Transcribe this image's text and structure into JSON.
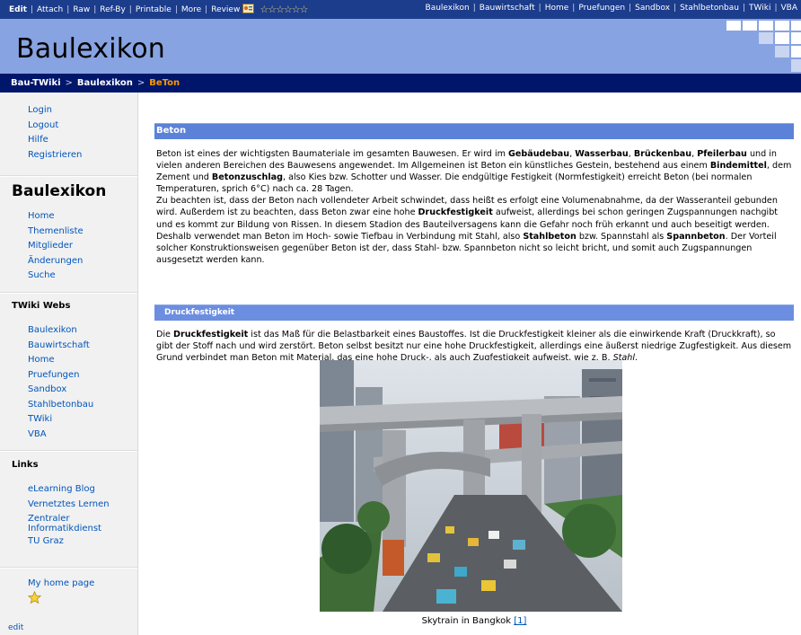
{
  "toolbar": {
    "actions": [
      "Edit",
      "Attach",
      "Raw",
      "Ref-By",
      "Printable",
      "More",
      "Review"
    ],
    "rating_stars": "☆☆☆☆☆☆",
    "webs": [
      "Baulexikon",
      "Bauwirtschaft",
      "Home",
      "Pruefungen",
      "Sandbox",
      "Stahlbetonbau",
      "TWiki",
      "VBA"
    ]
  },
  "header": {
    "title": "Baulexikon"
  },
  "breadcrumb": {
    "root": "Bau-TWiki",
    "sep": ">",
    "web": "Baulexikon",
    "current": "BeTon"
  },
  "sidebar": {
    "user_links": [
      "Login",
      "Logout",
      "Hilfe",
      "Registrieren"
    ],
    "web_title": "Baulexikon",
    "web_links": [
      "Home",
      "Themenliste",
      "Mitglieder",
      "Änderungen",
      "Suche"
    ],
    "webs_heading": "TWiki Webs",
    "webs": [
      "Baulexikon",
      "Bauwirtschaft",
      "Home",
      "Pruefungen",
      "Sandbox",
      "Stahlbetonbau",
      "TWiki",
      "VBA"
    ],
    "links_heading": "Links",
    "links": [
      "eLearning Blog",
      "Vernetztes Lernen",
      "Zentraler Informatikdienst",
      "TU Graz"
    ],
    "home_page": "My home page",
    "edit": "edit"
  },
  "content": {
    "section1_title": "Beton",
    "section1_text": [
      {
        "t": "Beton ist eines der wichtigsten Baumateriale im gesamten Bauwesen. Er wird im "
      },
      {
        "b": "Gebäudebau"
      },
      {
        "t": ", "
      },
      {
        "b": "Wasserbau"
      },
      {
        "t": ", "
      },
      {
        "b": "Brückenbau"
      },
      {
        "t": ", "
      },
      {
        "b": "Pfeilerbau"
      },
      {
        "t": " und in vielen anderen Bereichen des Bauwesens angewendet. Im Allgemeinen ist Beton ein künstliches Gestein, bestehend aus einem "
      },
      {
        "b": "Bindemittel"
      },
      {
        "t": ", dem Zement und "
      },
      {
        "b": "Betonzuschlag"
      },
      {
        "t": ", also Kies bzw. Schotter und Wasser. Die endgültige Festigkeit (Normfestigkeit) erreicht Beton (bei normalen Temperaturen, sprich 6°C) nach ca. 28 Tagen."
      },
      {
        "br": true
      },
      {
        "t": "Zu beachten ist, dass der Beton nach vollendeter Arbeit schwindet, dass heißt es erfolgt eine Volumenabnahme, da der Wasseranteil gebunden wird. Außerdem ist zu beachten, dass Beton zwar eine hohe "
      },
      {
        "b": "Druckfestigkeit"
      },
      {
        "t": " aufweist, allerdings bei schon geringen Zugspannungen nachgibt und es kommt zur Bildung von Rissen. In diesem Stadion des Bauteilversagens kann die Gefahr noch früh erkannt und auch beseitigt werden. Deshalb verwendet man Beton im Hoch- sowie Tiefbau in Verbindung mit Stahl, also "
      },
      {
        "b": "Stahlbeton"
      },
      {
        "t": " bzw. Spannstahl als "
      },
      {
        "b": "Spannbeton"
      },
      {
        "t": ". Der Vorteil solcher Konstruktionsweisen gegenüber Beton ist der, dass Stahl- bzw. Spannbeton nicht so leicht bricht, und somit auch Zugspannungen ausgesetzt werden kann."
      }
    ],
    "section2_title": "Druckfestigkeit",
    "section2_text": [
      {
        "t": "Die "
      },
      {
        "b": "Druckfestigkeit"
      },
      {
        "t": " ist das Maß für die Belastbarkeit eines Baustoffes. Ist die Druckfestigkeit kleiner als die einwirkende Kraft (Druckkraft), so gibt der Stoff nach und wird zerstört. Beton selbst besitzt nur eine hohe Druckfestigkeit, allerdings eine äußerst niedrige Zugfestigkeit. Aus diesem Grund verbindet man Beton mit Material, das eine hohe Druck-, als auch Zugfestigkeit aufweist, wie z. B. "
      },
      {
        "i": "Stahl"
      },
      {
        "t": "."
      }
    ],
    "caption": "Skytrain in Bangkok",
    "caption_ref": "[1]"
  },
  "colors": {
    "toolbar": "#1c3c8c",
    "header": "#88a3e1",
    "breadcrumb": "#00166b",
    "section": "#5b82d8",
    "link": "#0055bb",
    "current": "#ff9900"
  }
}
